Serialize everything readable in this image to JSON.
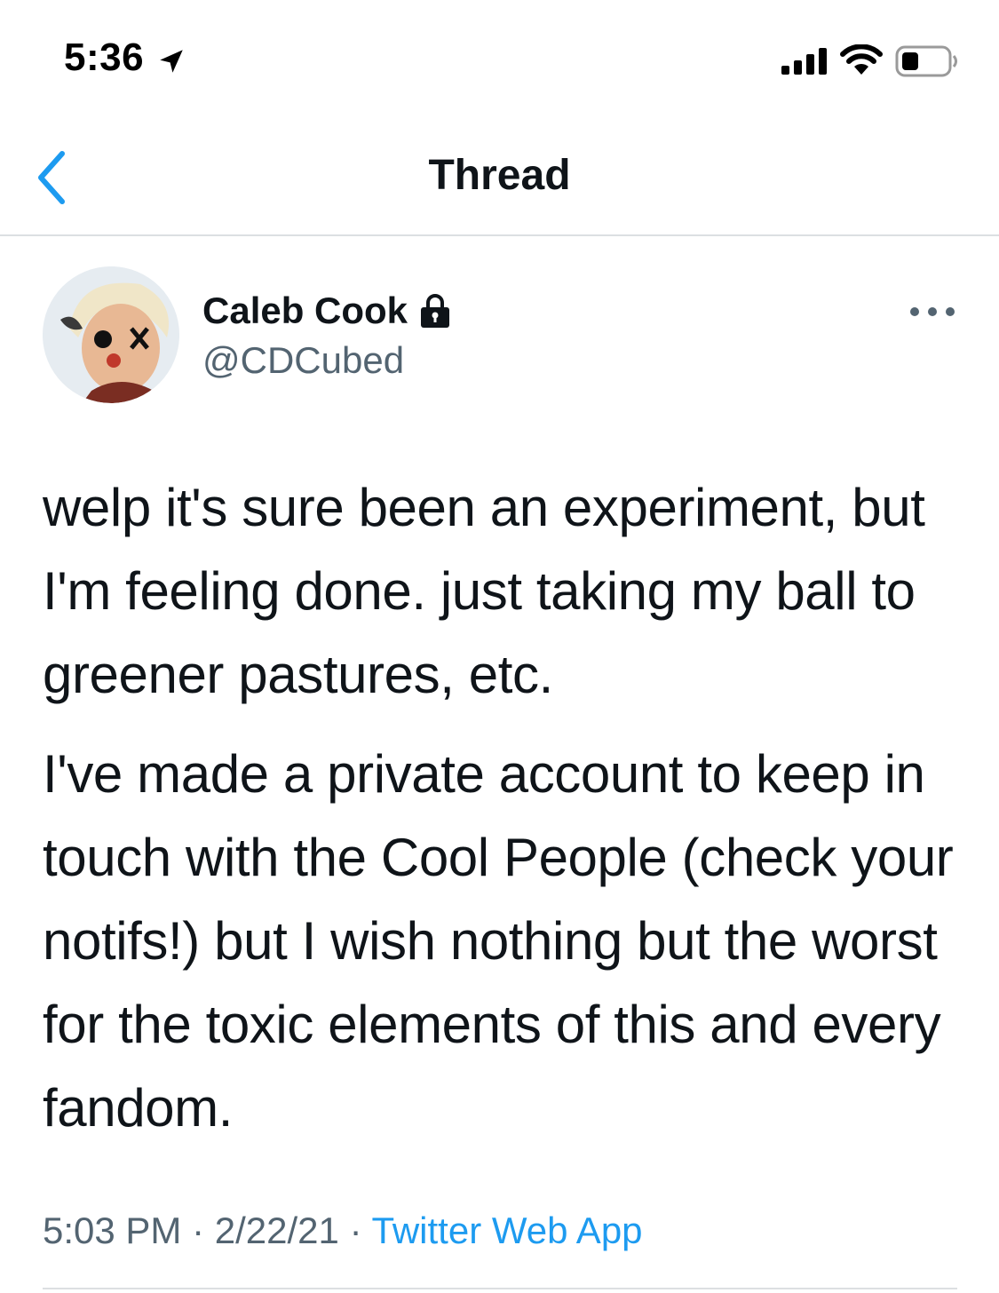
{
  "status_bar": {
    "time": "5:36",
    "icons": [
      "location-arrow-icon",
      "cellular-signal-icon",
      "wifi-icon",
      "battery-icon"
    ]
  },
  "nav": {
    "title": "Thread",
    "back_icon": "chevron-left-icon"
  },
  "tweet": {
    "author": {
      "display_name": "Caleb Cook",
      "handle": "@CDCubed",
      "protected_icon": "lock-icon"
    },
    "more_icon": "more-horizontal-icon",
    "paragraphs": [
      "welp it's sure been an experiment, but I'm feeling done. just taking my ball to greener pastures, etc.",
      "I've made a private account to keep in touch with the Cool People (check your notifs!) but I wish nothing but the worst for the toxic elements of this and every fandom."
    ],
    "time": "5:03 PM",
    "separator": "·",
    "date": "2/22/21",
    "source": "Twitter Web App"
  },
  "colors": {
    "accent": "#1d9bf0",
    "text_primary": "#0f1419",
    "text_secondary": "#536471",
    "divider": "#dcdfe2"
  }
}
